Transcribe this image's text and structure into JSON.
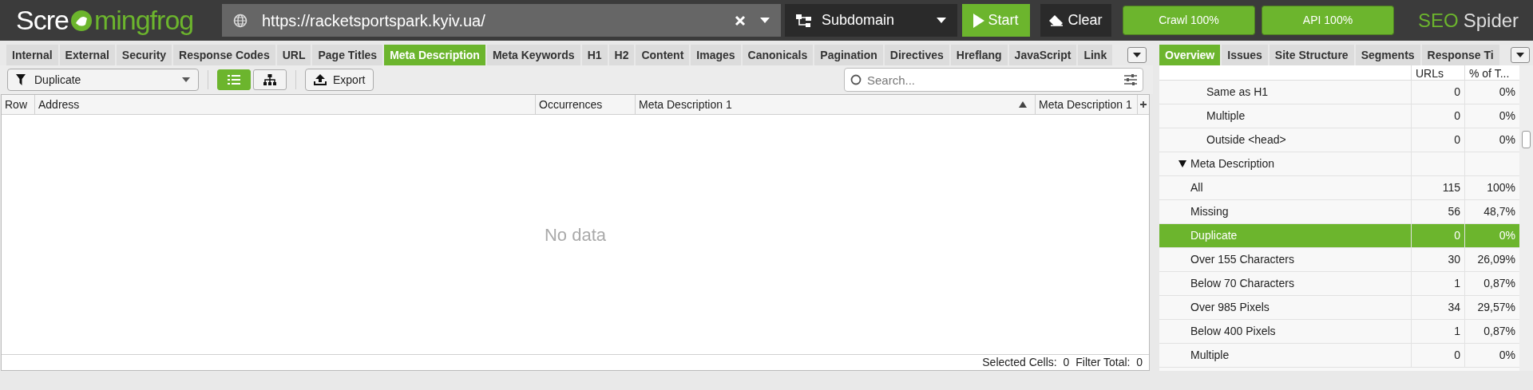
{
  "top_bar": {
    "logo": {
      "before": "Scre",
      "after": "mingfrog"
    },
    "url": "https://racketsportspark.kyiv.ua/",
    "scope": "Subdomain",
    "start": "Start",
    "clear": "Clear",
    "progress": [
      {
        "label": "Crawl 100%",
        "level": 1
      },
      {
        "label": "API 100%",
        "level": 1
      }
    ],
    "product": {
      "first": "SEO",
      "second": "Spider"
    }
  },
  "tabs": [
    {
      "label": "Internal",
      "selected": false
    },
    {
      "label": "External",
      "selected": false
    },
    {
      "label": "Security",
      "selected": false
    },
    {
      "label": "Response Codes",
      "selected": false
    },
    {
      "label": "URL",
      "selected": false
    },
    {
      "label": "Page Titles",
      "selected": false
    },
    {
      "label": "Meta Description",
      "selected": true
    },
    {
      "label": "Meta Keywords",
      "selected": false
    },
    {
      "label": "H1",
      "selected": false
    },
    {
      "label": "H2",
      "selected": false
    },
    {
      "label": "Content",
      "selected": false
    },
    {
      "label": "Images",
      "selected": false
    },
    {
      "label": "Canonicals",
      "selected": false
    },
    {
      "label": "Pagination",
      "selected": false
    },
    {
      "label": "Directives",
      "selected": false
    },
    {
      "label": "Hreflang",
      "selected": false
    },
    {
      "label": "JavaScript",
      "selected": false
    },
    {
      "label": "Link",
      "selected": false
    }
  ],
  "toolbar": {
    "filter": "Duplicate",
    "views": [
      {
        "kind": "list",
        "selected": true
      },
      {
        "kind": "tree",
        "selected": false
      }
    ],
    "export": "Export",
    "search_placeholder": "Search..."
  },
  "table": {
    "columns": [
      {
        "label": "Row"
      },
      {
        "label": "Address"
      },
      {
        "label": "Occurrences"
      },
      {
        "label": "Meta Description 1",
        "sorted": true
      },
      {
        "label": "Meta Description 1"
      }
    ],
    "empty_text": "No data"
  },
  "status_bar": {
    "selected_cells": "Selected Cells:  0",
    "filter_total": "Filter Total:  0"
  },
  "right_panel": {
    "tabs": [
      {
        "label": "Overview",
        "selected": true
      },
      {
        "label": "Issues",
        "selected": false
      },
      {
        "label": "Site Structure",
        "selected": false
      },
      {
        "label": "Segments",
        "selected": false
      },
      {
        "label": "Response Ti",
        "selected": false
      }
    ],
    "columns": [
      "URLs",
      "% of T..."
    ],
    "rows": [
      {
        "kind": "item",
        "label": "Same as H1",
        "urls": "0",
        "percent": "0%",
        "selected": false
      },
      {
        "kind": "item",
        "label": "Multiple",
        "urls": "0",
        "percent": "0%",
        "selected": false
      },
      {
        "kind": "item",
        "label": "Outside <head>",
        "urls": "0",
        "percent": "0%",
        "selected": false
      },
      {
        "kind": "group",
        "label": "Meta Description",
        "expanded": true,
        "children": [
          {
            "kind": "item",
            "label": "All",
            "urls": "115",
            "percent": "100%",
            "selected": false
          },
          {
            "kind": "item",
            "label": "Missing",
            "urls": "56",
            "percent": "48,7%",
            "selected": false
          },
          {
            "kind": "item",
            "label": "Duplicate",
            "urls": "0",
            "percent": "0%",
            "selected": true
          },
          {
            "kind": "item",
            "label": "Over 155 Characters",
            "urls": "30",
            "percent": "26,09%",
            "selected": false
          },
          {
            "kind": "item",
            "label": "Below 70 Characters",
            "urls": "1",
            "percent": "0,87%",
            "selected": false
          },
          {
            "kind": "item",
            "label": "Over 985 Pixels",
            "urls": "34",
            "percent": "29,57%",
            "selected": false
          },
          {
            "kind": "item",
            "label": "Below 400 Pixels",
            "urls": "1",
            "percent": "0,87%",
            "selected": false
          },
          {
            "kind": "item",
            "label": "Multiple",
            "urls": "0",
            "percent": "0%",
            "selected": false
          }
        ]
      }
    ]
  }
}
